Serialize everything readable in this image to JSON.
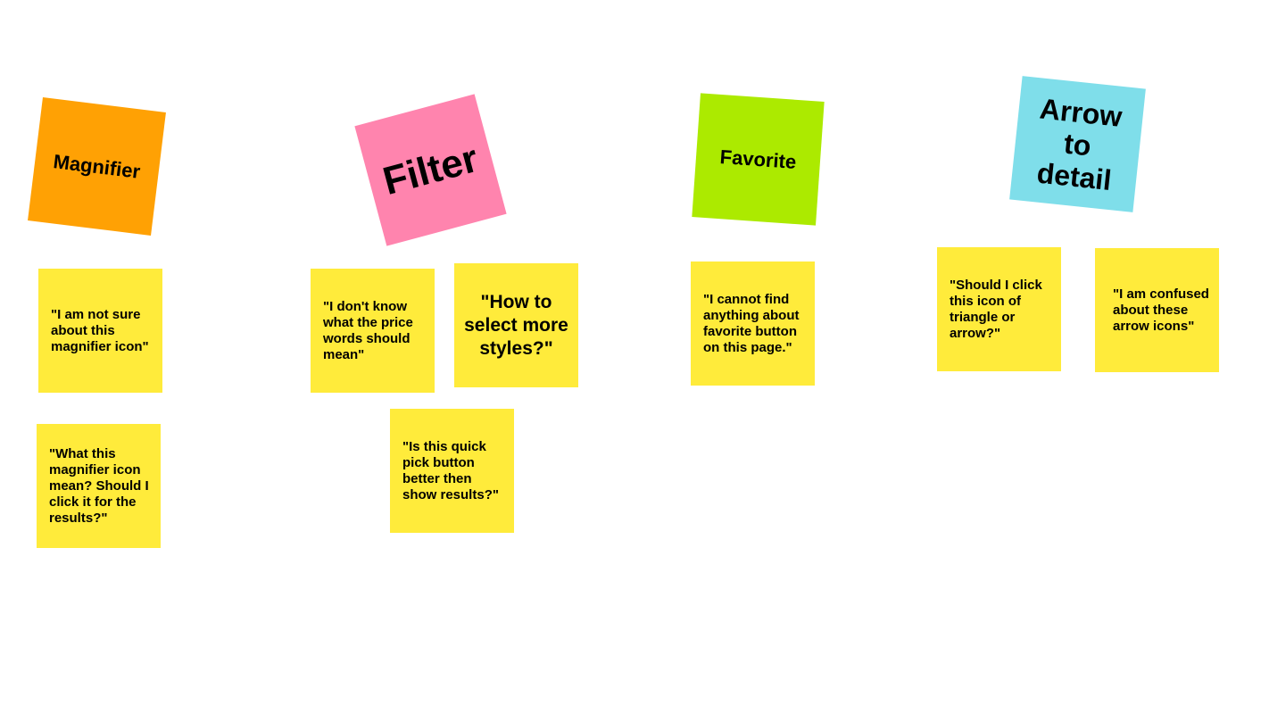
{
  "board": {
    "colors": {
      "orange": "#ffa104",
      "pink": "#ff84ae",
      "lime": "#acea00",
      "cyan": "#7fdeea",
      "yellow": "#ffeb3b",
      "text": "#000000"
    },
    "columns": [
      {
        "header": "Magnifier",
        "notes": [
          "\"I am not sure about this magnifier icon\"",
          "\"What this magnifier icon mean? Should I click it for the results?\""
        ]
      },
      {
        "header": "Filter",
        "notes": [
          "\"I don't know what the price words should mean\"",
          "\"How to select more styles?\"",
          "\"Is this quick pick button better then show results?\""
        ]
      },
      {
        "header": "Favorite",
        "notes": [
          "\"I cannot find anything about favorite button on this page.\""
        ]
      },
      {
        "header": "Arrow to detail",
        "notes": [
          "\"Should I click this icon of triangle or arrow?\"",
          "\"I am confused about these arrow icons\""
        ]
      }
    ]
  }
}
